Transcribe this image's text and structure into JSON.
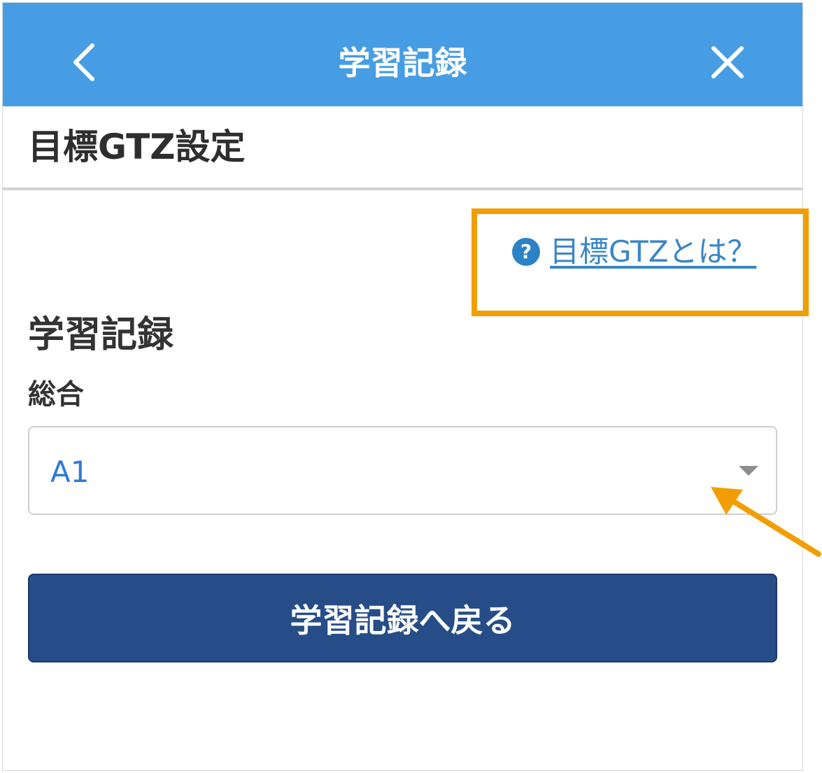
{
  "header": {
    "title": "学習記録",
    "back_icon": "chevron-left-icon",
    "close_icon": "close-icon",
    "background_color": "#479de3"
  },
  "page": {
    "title": "目標GTZ設定"
  },
  "help": {
    "icon": "question-circle-icon",
    "icon_glyph": "?",
    "link_text": "目標GTZとは？"
  },
  "section": {
    "title": "学習記録"
  },
  "field": {
    "label": "総合",
    "selected_value": "A1"
  },
  "actions": {
    "back_label": "学習記録へ戻る"
  },
  "annotations": {
    "highlight_color": "#f29e03"
  }
}
